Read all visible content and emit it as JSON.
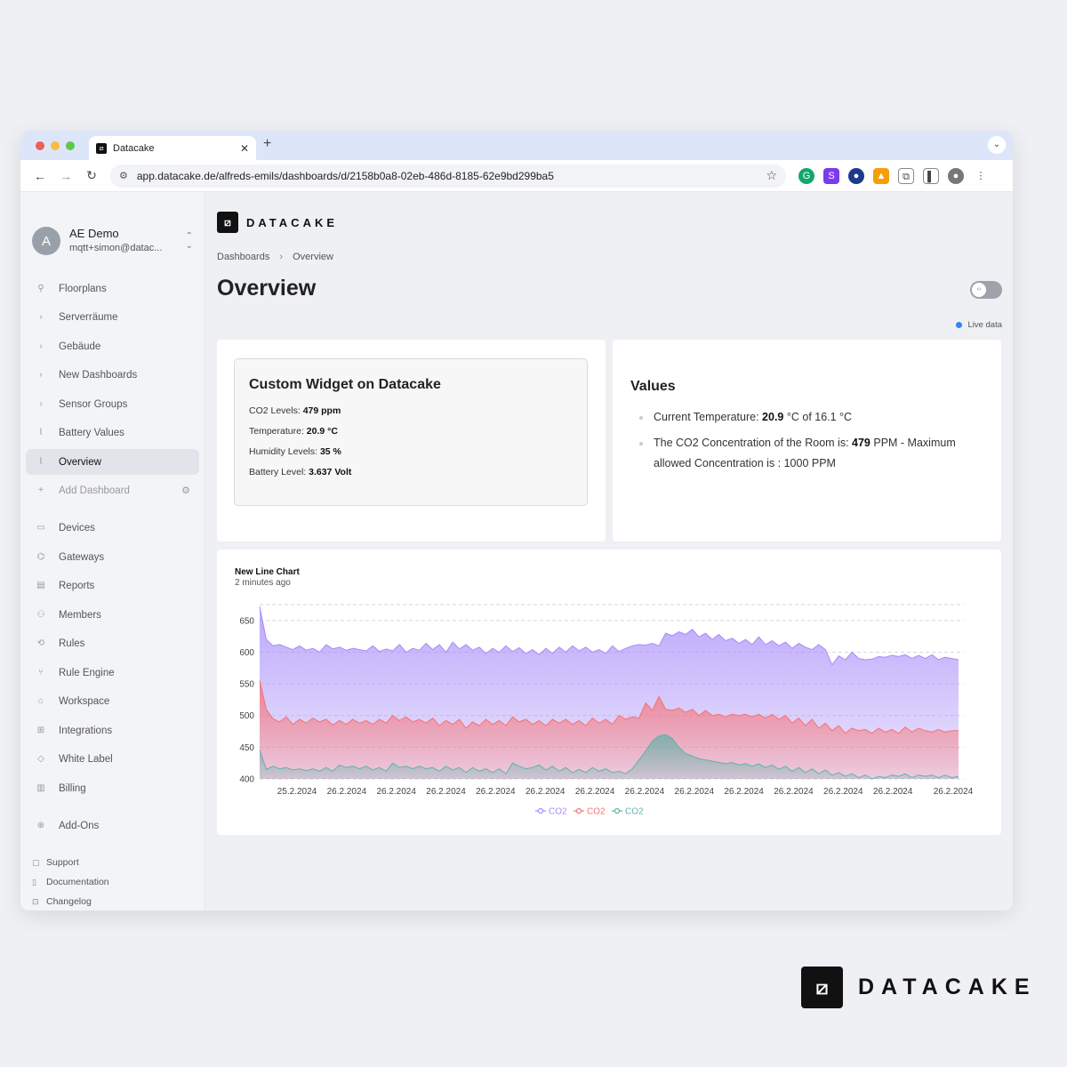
{
  "browser": {
    "tab_title": "Datacake",
    "tab_close": "✕",
    "new_tab": "+",
    "url": "app.datacake.de/alfreds-emils/dashboards/d/2158b0a8-02eb-486d-8185-62e9bd299ba5",
    "dots": [
      "#ee5f57",
      "#f5be3d",
      "#5ec84b"
    ]
  },
  "account": {
    "initial": "A",
    "name": "AE Demo",
    "email": "mqtt+simon@datac..."
  },
  "sidebar": {
    "dashboards": [
      {
        "label": "Floorplans",
        "icon": "pin-icon"
      },
      {
        "label": "Serverräume",
        "icon": "chevron-right-icon"
      },
      {
        "label": "Gebäude",
        "icon": "chevron-right-icon"
      },
      {
        "label": "New Dashboards",
        "icon": "chevron-right-icon"
      },
      {
        "label": "Sensor Groups",
        "icon": "chevron-right-icon"
      },
      {
        "label": "Battery Values",
        "icon": "chart-icon"
      },
      {
        "label": "Overview",
        "icon": "chart-icon",
        "active": true
      },
      {
        "label": "Add Dashboard",
        "icon": "plus-icon"
      }
    ],
    "main": [
      {
        "label": "Devices",
        "icon": "devices-icon"
      },
      {
        "label": "Gateways",
        "icon": "gateway-icon"
      },
      {
        "label": "Reports",
        "icon": "report-icon"
      },
      {
        "label": "Members",
        "icon": "members-icon"
      },
      {
        "label": "Rules",
        "icon": "rules-icon"
      },
      {
        "label": "Rule Engine",
        "icon": "rule-engine-icon"
      },
      {
        "label": "Workspace",
        "icon": "workspace-icon"
      },
      {
        "label": "Integrations",
        "icon": "integrations-icon"
      },
      {
        "label": "White Label",
        "icon": "tag-icon"
      },
      {
        "label": "Billing",
        "icon": "billing-icon"
      },
      {
        "label": "Add-Ons",
        "icon": "addons-icon"
      }
    ],
    "footer": [
      {
        "label": "Support",
        "icon": "chat-icon"
      },
      {
        "label": "Documentation",
        "icon": "book-icon"
      },
      {
        "label": "Changelog",
        "icon": "gift-icon"
      }
    ]
  },
  "header": {
    "brand": "DATACAKE",
    "breadcrumb": [
      "Dashboards",
      "Overview"
    ],
    "title": "Overview",
    "live_label": "Live data"
  },
  "widget": {
    "title": "Custom Widget on Datacake",
    "rows": [
      {
        "label": "CO2 Levels:",
        "value": "479 ppm"
      },
      {
        "label": "Temperature:",
        "value": "20.9 °C"
      },
      {
        "label": "Humidity Levels:",
        "value": "35 %"
      },
      {
        "label": "Battery Level:",
        "value": "3.637 Volt"
      }
    ]
  },
  "values_card": {
    "title": "Values",
    "item1_prefix": "Current Temperature: ",
    "item1_bold": "20.9",
    "item1_suffix": " °C of 16.1 °C",
    "item2_prefix": "The CO2 Concentration of the Room is: ",
    "item2_bold": "479",
    "item2_suffix": " PPM - Maximum allowed Concentration is : 1000 PPM"
  },
  "chart_meta": {
    "title": "New Line Chart",
    "subtitle": "2 minutes ago"
  },
  "chart_data": {
    "type": "area",
    "title": "New Line Chart",
    "ylim": [
      400,
      675
    ],
    "yticks": [
      400,
      450,
      500,
      550,
      600,
      650
    ],
    "xtick_labels": [
      "25.2.2024",
      "26.2.2024",
      "26.2.2024",
      "26.2.2024",
      "26.2.2024",
      "26.2.2024",
      "26.2.2024",
      "26.2.2024",
      "26.2.2024",
      "26.2.2024",
      "26.2.2024",
      "26.2.2024",
      "26.2.2024",
      "26.2.2024"
    ],
    "grid": true,
    "legend": "bottom-center",
    "series": [
      {
        "name": "CO2",
        "color": "#a78bfa",
        "values": [
          672,
          620,
          610,
          612,
          608,
          604,
          610,
          603,
          606,
          600,
          612,
          605,
          608,
          603,
          606,
          604,
          602,
          610,
          601,
          605,
          602,
          612,
          600,
          606,
          603,
          614,
          604,
          612,
          600,
          616,
          605,
          612,
          603,
          608,
          598,
          606,
          600,
          610,
          601,
          607,
          598,
          604,
          596,
          606,
          598,
          608,
          600,
          610,
          602,
          608,
          600,
          604,
          598,
          610,
          601,
          606,
          610,
          612,
          611,
          614,
          610,
          630,
          626,
          632,
          628,
          636,
          624,
          630,
          620,
          628,
          618,
          622,
          614,
          620,
          612,
          624,
          612,
          618,
          610,
          616,
          606,
          614,
          608,
          604,
          612,
          604,
          580,
          594,
          588,
          600,
          590,
          588,
          589,
          593,
          592,
          595,
          593,
          596,
          590,
          595,
          590,
          596,
          588,
          592,
          590,
          588
        ]
      },
      {
        "name": "CO2",
        "color": "#f87171",
        "values": [
          555,
          510,
          495,
          490,
          498,
          486,
          494,
          488,
          496,
          490,
          494,
          485,
          492,
          486,
          494,
          488,
          492,
          486,
          494,
          488,
          500,
          492,
          498,
          490,
          494,
          488,
          496,
          484,
          492,
          486,
          494,
          480,
          490,
          484,
          494,
          486,
          492,
          484,
          498,
          490,
          494,
          486,
          492,
          484,
          494,
          488,
          494,
          486,
          492,
          484,
          496,
          488,
          494,
          486,
          500,
          494,
          498,
          496,
          520,
          508,
          530,
          510,
          508,
          512,
          505,
          510,
          500,
          508,
          500,
          502,
          498,
          502,
          500,
          502,
          498,
          502,
          496,
          502,
          494,
          500,
          488,
          496,
          484,
          494,
          480,
          488,
          476,
          484,
          472,
          480,
          476,
          478,
          472,
          480,
          474,
          478,
          472,
          482,
          474,
          480,
          476,
          474,
          478,
          474,
          476,
          476
        ]
      },
      {
        "name": "CO2",
        "color": "#5fb3a8",
        "values": [
          445,
          415,
          420,
          416,
          418,
          414,
          416,
          413,
          416,
          412,
          418,
          412,
          422,
          418,
          420,
          416,
          420,
          414,
          418,
          412,
          425,
          418,
          420,
          416,
          420,
          416,
          418,
          412,
          420,
          414,
          418,
          410,
          418,
          412,
          416,
          410,
          416,
          408,
          425,
          420,
          416,
          418,
          422,
          414,
          420,
          412,
          418,
          410,
          415,
          410,
          418,
          412,
          416,
          410,
          412,
          408,
          416,
          430,
          444,
          460,
          468,
          470,
          464,
          450,
          440,
          436,
          432,
          430,
          428,
          426,
          424,
          426,
          422,
          424,
          420,
          424,
          418,
          422,
          415,
          420,
          412,
          418,
          410,
          416,
          408,
          414,
          406,
          410,
          404,
          408,
          402,
          406,
          400,
          404,
          402,
          406,
          404,
          408,
          402,
          406,
          404,
          406,
          402,
          406,
          402,
          404
        ]
      }
    ]
  }
}
